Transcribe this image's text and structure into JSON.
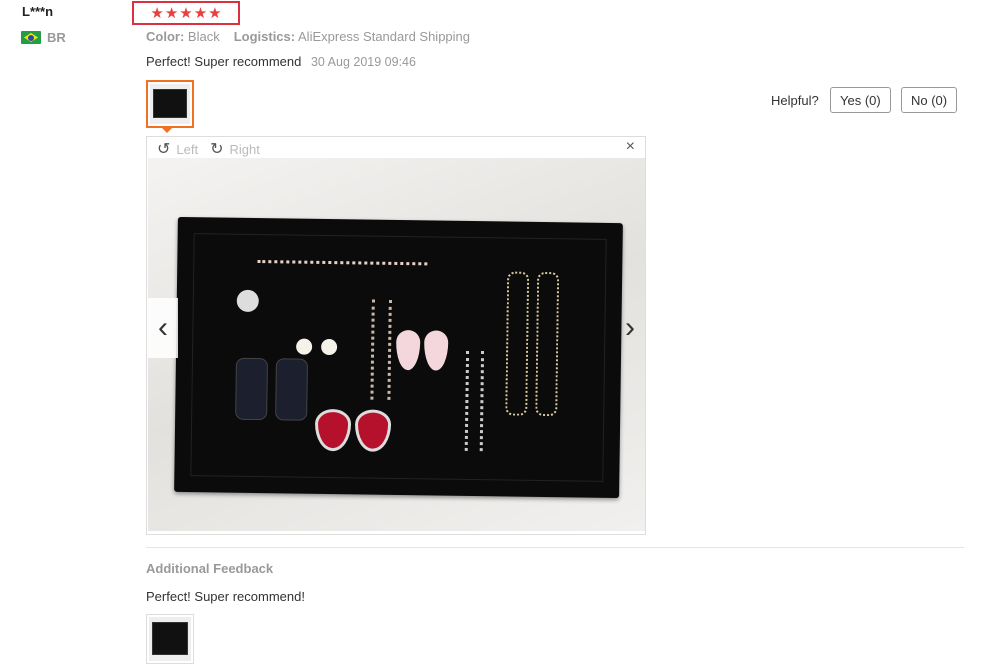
{
  "reviewer": {
    "name": "L***n",
    "country": "BR",
    "flag_icon": "brazil-flag-icon"
  },
  "rating": {
    "stars": 5,
    "max": 5,
    "star_icon": "star-icon",
    "star_glyph": "★"
  },
  "meta": {
    "color_label": "Color:",
    "color_value": "Black",
    "logistics_label": "Logistics:",
    "logistics_value": "AliExpress Standard Shipping"
  },
  "review": {
    "text": "Perfect! Super recommend",
    "date": "30 Aug 2019 09:46"
  },
  "helpful": {
    "label": "Helpful?",
    "yes": "Yes (0)",
    "no": "No (0)"
  },
  "viewer": {
    "rotate_left": "Left",
    "rotate_right": "Right",
    "close": "×",
    "prev": "‹",
    "next": "›"
  },
  "additional": {
    "title": "Additional Feedback",
    "text": "Perfect! Super recommend!"
  },
  "colors": {
    "accent": "#f36f21",
    "star": "#e8403f",
    "highlight_box": "#d9313f"
  }
}
